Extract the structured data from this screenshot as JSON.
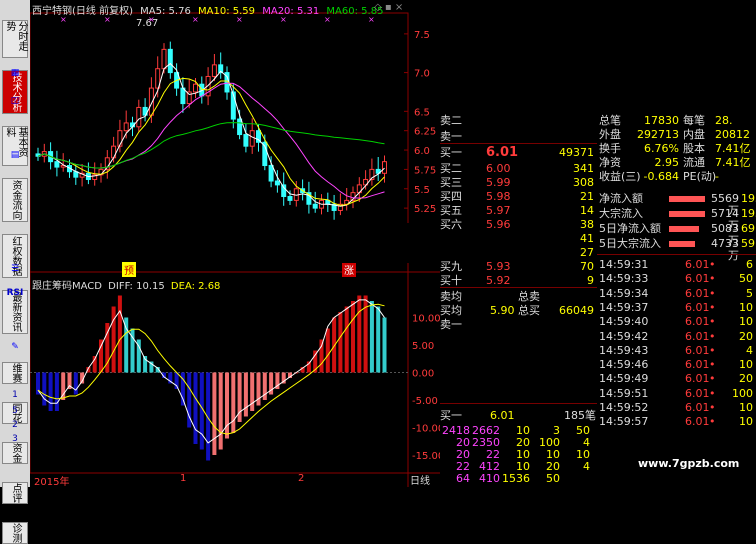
{
  "sidebar": {
    "tabs": [
      {
        "label": "分时走势",
        "active": false
      },
      {
        "label": "技术分析",
        "active": true
      },
      {
        "label": "基本资料",
        "active": false
      },
      {
        "label": "资金流向",
        "active": false
      },
      {
        "label": "红权数据",
        "active": false
      },
      {
        "label": "最新资讯",
        "active": false
      },
      {
        "label": "维赛",
        "active": false
      },
      {
        "label": "同花",
        "active": false
      },
      {
        "label": "资金",
        "active": false
      },
      {
        "label": "点评",
        "active": false
      },
      {
        "label": "诊测",
        "active": false
      }
    ],
    "numbers": [
      "1",
      "5",
      "2",
      "3"
    ],
    "rsi_label": "RSI"
  },
  "header": {
    "stock": "西宁特钢(日线 前复权)",
    "ma5": "MA5: 5.76",
    "ma10": "MA10: 5.59",
    "ma20": "MA20: 5.31",
    "ma60": "MA60: 5.85"
  },
  "price_axis": [
    "7.5",
    "7.0",
    "6.5",
    "6.25",
    "6.0",
    "5.75",
    "5.5",
    "5.25"
  ],
  "high_label": "7.67",
  "macd": {
    "title": "跟庄筹码MACD",
    "diff": "DIFF: 10.15",
    "dea": "DEA: 2.68",
    "axis": [
      "10.00",
      "5.00",
      "0.00",
      "-5.00",
      "-10.00",
      "-15.00"
    ]
  },
  "time_axis": {
    "year": "2015年",
    "m1": "1",
    "m2": "2",
    "period": "日线"
  },
  "event_marks": {
    "left": "预",
    "right": "涨"
  },
  "stats": [
    {
      "k1": "总笔",
      "v1": "17830",
      "k2": "每笔",
      "v2": "28."
    },
    {
      "k1": "外盘",
      "v1": "292713",
      "k2": "内盘",
      "v2": "20812"
    },
    {
      "k1": "换手",
      "v1": "6.76%",
      "k2": "股本",
      "v2": "7.41亿"
    },
    {
      "k1": "净资",
      "v1": "2.95",
      "k2": "流通",
      "v2": "7.41亿"
    },
    {
      "k1": "收益(三)",
      "v1": "-0.684",
      "k2": "PE(动)",
      "v2": "-"
    }
  ],
  "flows": [
    {
      "label": "净流入额",
      "value": "5569万",
      "extra": "195"
    },
    {
      "label": "大宗流入",
      "value": "5714万",
      "extra": "195"
    },
    {
      "label": "5日净流入额",
      "value": "5083万",
      "extra": "69"
    },
    {
      "label": "5日大宗流入",
      "value": "4733万",
      "extra": "59"
    }
  ],
  "sells_top": [
    {
      "label": "卖二"
    },
    {
      "label": "卖一"
    }
  ],
  "current_price": "6.01",
  "current_vol": "49371",
  "buys": [
    {
      "label": "买二",
      "price": "6.00",
      "vol": "341"
    },
    {
      "label": "买三",
      "price": "5.99",
      "vol": "308"
    },
    {
      "label": "买四",
      "price": "5.98",
      "vol": "21"
    },
    {
      "label": "买五",
      "price": "5.97",
      "vol": "14"
    },
    {
      "label": "买六",
      "price": "5.96",
      "vol": "38"
    },
    {
      "label": "",
      "price": "",
      "vol": "41"
    },
    {
      "label": "",
      "price": "",
      "vol": "27"
    },
    {
      "label": "买九",
      "price": "5.93",
      "vol": "70"
    },
    {
      "label": "买十",
      "price": "5.92",
      "vol": "9"
    }
  ],
  "avg": {
    "sell_avg": "卖均",
    "total_sell": "总卖",
    "buy_avg": "买均",
    "buy_avg_val": "5.90",
    "total_buy": "总买",
    "total_buy_val": "66049",
    "sell1": "卖一"
  },
  "bottom_quote": {
    "label": "买一",
    "price": "6.01",
    "vol": "185笔"
  },
  "order_queue": [
    [
      "2418",
      "2662",
      "10",
      "3",
      "50"
    ],
    [
      "20",
      "2350",
      "20",
      "100",
      "4"
    ],
    [
      "20",
      "22",
      "10",
      "10",
      "10"
    ],
    [
      "22",
      "412",
      "10",
      "20",
      "4"
    ],
    [
      "64",
      "410",
      "1536",
      "50",
      ""
    ]
  ],
  "ticks": [
    {
      "time": "14:59:31",
      "price": "6.01",
      "vol": "6"
    },
    {
      "time": "14:59:33",
      "price": "6.01",
      "vol": "50"
    },
    {
      "time": "14:59:34",
      "price": "6.01",
      "vol": "5"
    },
    {
      "time": "14:59:37",
      "price": "6.01",
      "vol": "10"
    },
    {
      "time": "14:59:40",
      "price": "6.01",
      "vol": "10"
    },
    {
      "time": "14:59:42",
      "price": "6.01",
      "vol": "20"
    },
    {
      "time": "14:59:43",
      "price": "6.01",
      "vol": "4"
    },
    {
      "time": "14:59:46",
      "price": "6.01",
      "vol": "10"
    },
    {
      "time": "14:59:49",
      "price": "6.01",
      "vol": "20"
    },
    {
      "time": "14:59:51",
      "price": "6.01",
      "vol": "100"
    },
    {
      "time": "14:59:52",
      "price": "6.01",
      "vol": "10"
    },
    {
      "time": "14:59:57",
      "price": "6.01",
      "vol": "10"
    }
  ],
  "watermark": "www.7gpzb.com",
  "colors": {
    "up": "#ff3b3b",
    "down": "#33ffff",
    "ma5": "#ffffff",
    "ma10": "#ffff00",
    "ma20": "#ff44ff",
    "ma60": "#00d000"
  }
}
